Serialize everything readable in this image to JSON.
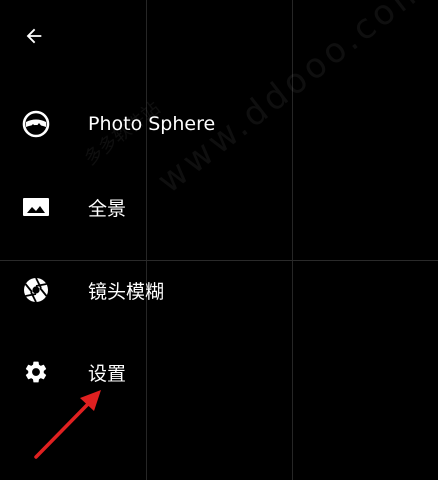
{
  "header": {
    "back_icon": "arrow-back-icon"
  },
  "menu": [
    {
      "label": "Photo Sphere",
      "icon": "photo-sphere-icon"
    },
    {
      "label": "全景",
      "icon": "panorama-icon"
    },
    {
      "label": "镜头模糊",
      "icon": "aperture-icon"
    },
    {
      "label": "设置",
      "icon": "gear-icon"
    }
  ],
  "watermark": {
    "site": "www.ddooo.com",
    "cn": "多多软件站"
  },
  "colors": {
    "background": "#000000",
    "text": "#ffffff",
    "grid_line": "#262626",
    "annotation_arrow": "#e02020"
  }
}
